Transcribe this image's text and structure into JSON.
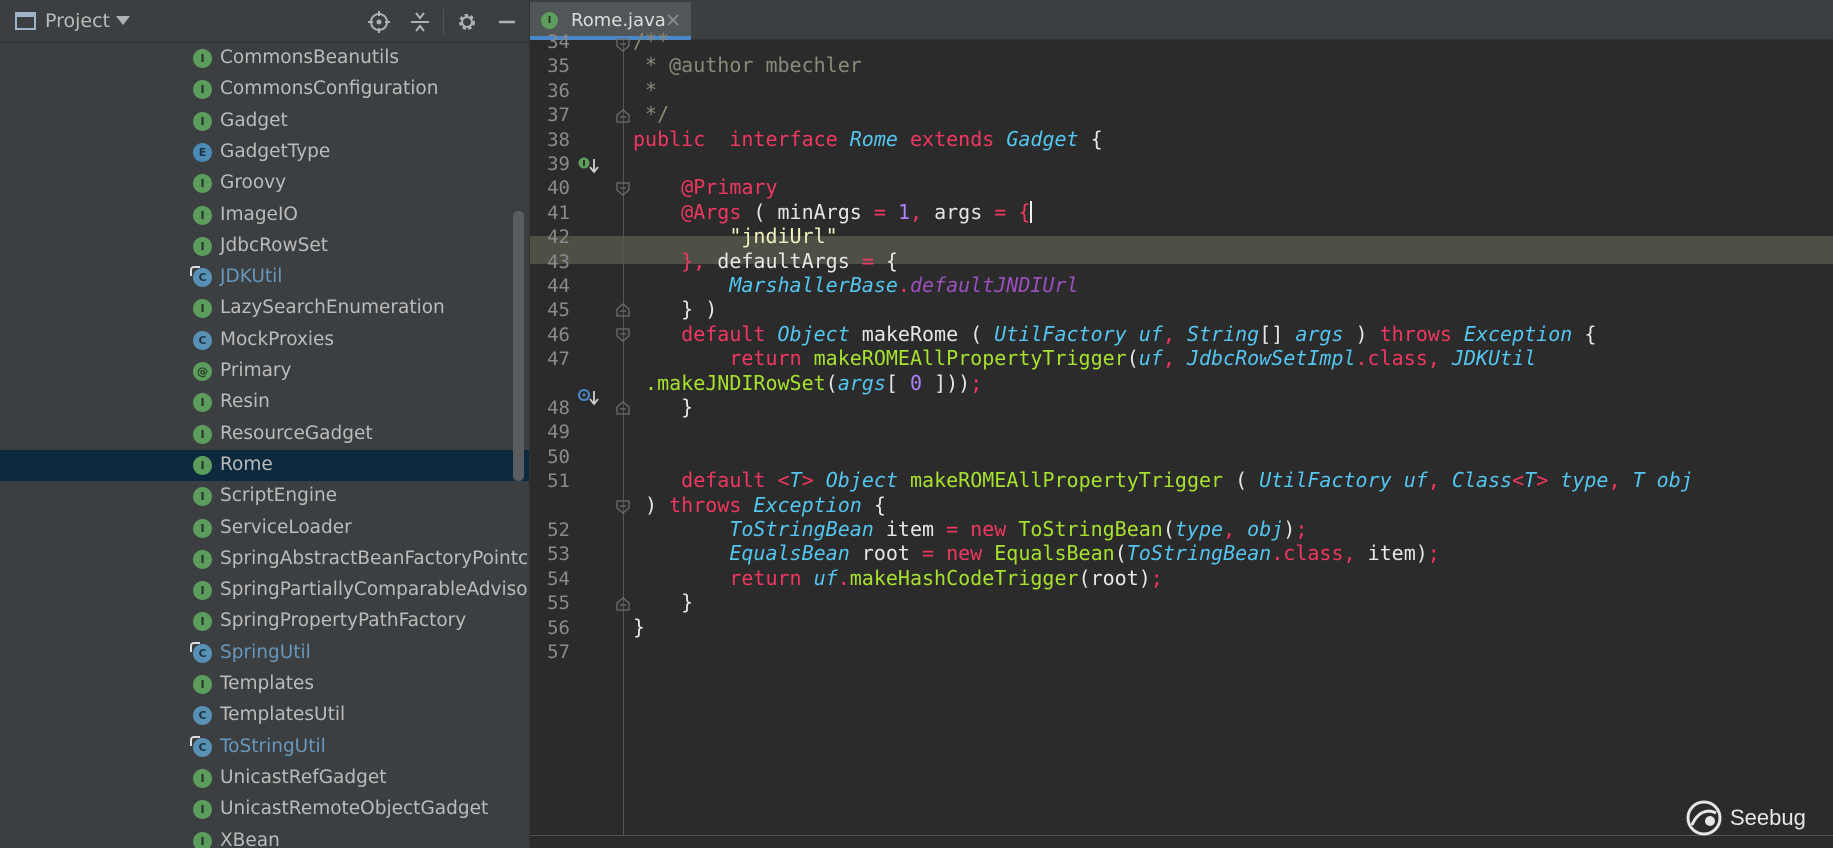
{
  "project_panel": {
    "title": "Project",
    "tree_items": [
      {
        "label": "CommonsBeanutils",
        "kind": "interface",
        "icon_letter": "I"
      },
      {
        "label": "CommonsConfiguration",
        "kind": "interface",
        "icon_letter": "I"
      },
      {
        "label": "Gadget",
        "kind": "interface",
        "icon_letter": "I"
      },
      {
        "label": "GadgetType",
        "kind": "enum",
        "icon_letter": "E"
      },
      {
        "label": "Groovy",
        "kind": "interface",
        "icon_letter": "I"
      },
      {
        "label": "ImageIO",
        "kind": "interface",
        "icon_letter": "I"
      },
      {
        "label": "JdbcRowSet",
        "kind": "interface",
        "icon_letter": "I"
      },
      {
        "label": "JDKUtil",
        "kind": "class-ext",
        "icon_letter": "C"
      },
      {
        "label": "LazySearchEnumeration",
        "kind": "interface",
        "icon_letter": "I"
      },
      {
        "label": "MockProxies",
        "kind": "class",
        "icon_letter": "C"
      },
      {
        "label": "Primary",
        "kind": "annotation",
        "icon_letter": "@"
      },
      {
        "label": "Resin",
        "kind": "interface",
        "icon_letter": "I"
      },
      {
        "label": "ResourceGadget",
        "kind": "interface",
        "icon_letter": "I"
      },
      {
        "label": "Rome",
        "kind": "interface",
        "icon_letter": "I",
        "selected": true
      },
      {
        "label": "ScriptEngine",
        "kind": "interface",
        "icon_letter": "I"
      },
      {
        "label": "ServiceLoader",
        "kind": "interface",
        "icon_letter": "I"
      },
      {
        "label": "SpringAbstractBeanFactoryPointcut",
        "kind": "interface",
        "icon_letter": "I"
      },
      {
        "label": "SpringPartiallyComparableAdvisorH",
        "kind": "interface",
        "icon_letter": "I"
      },
      {
        "label": "SpringPropertyPathFactory",
        "kind": "interface",
        "icon_letter": "I"
      },
      {
        "label": "SpringUtil",
        "kind": "class-ext",
        "icon_letter": "C"
      },
      {
        "label": "Templates",
        "kind": "interface",
        "icon_letter": "I"
      },
      {
        "label": "TemplatesUtil",
        "kind": "class",
        "icon_letter": "C"
      },
      {
        "label": "ToStringUtil",
        "kind": "class-ext",
        "icon_letter": "C"
      },
      {
        "label": "UnicastRefGadget",
        "kind": "interface",
        "icon_letter": "I"
      },
      {
        "label": "UnicastRemoteObjectGadget",
        "kind": "interface",
        "icon_letter": "I"
      },
      {
        "label": "XBean",
        "kind": "interface",
        "icon_letter": "I"
      }
    ]
  },
  "editor": {
    "tab": {
      "label": "Rome.java",
      "icon_letter": "I"
    },
    "caret_line_number": "41",
    "line_numbers": [
      "34",
      "35",
      "36",
      "37",
      "38",
      "39",
      "40",
      "41",
      "42",
      "43",
      "44",
      "45",
      "46",
      "47",
      "",
      "48",
      "49",
      "50",
      "51",
      "",
      "52",
      "53",
      "54",
      "55",
      "56",
      "57"
    ],
    "code_lines": [
      [
        [
          "cm",
          "/**"
        ]
      ],
      [
        [
          "cm",
          " * @author mbechler"
        ]
      ],
      [
        [
          "cm",
          " *"
        ]
      ],
      [
        [
          "cm",
          " */"
        ]
      ],
      [
        [
          "kw",
          "public"
        ],
        [
          "",
          "  "
        ],
        [
          "kw",
          "interface"
        ],
        [
          "",
          " "
        ],
        [
          "ty",
          "Rome"
        ],
        [
          "",
          " "
        ],
        [
          "kw",
          "extends"
        ],
        [
          "",
          " "
        ],
        [
          "ty",
          "Gadget"
        ],
        [
          "",
          " {"
        ]
      ],
      [
        [
          "",
          ""
        ]
      ],
      [
        [
          "",
          "    "
        ],
        [
          "an",
          "@Primary"
        ]
      ],
      [
        [
          "",
          "    "
        ],
        [
          "an",
          "@Args"
        ],
        [
          "",
          " ( minArgs "
        ],
        [
          "op",
          "="
        ],
        [
          "",
          " "
        ],
        [
          "nm",
          "1"
        ],
        [
          "op",
          ","
        ],
        [
          "",
          " args "
        ],
        [
          "op",
          "="
        ],
        [
          "",
          " "
        ],
        [
          "op",
          "{"
        ]
      ],
      [
        [
          "",
          "        "
        ],
        [
          "st",
          "\"jndiUrl\""
        ]
      ],
      [
        [
          "",
          "    "
        ],
        [
          "op",
          "},"
        ],
        [
          "",
          " defaultArgs "
        ],
        [
          "op",
          "="
        ],
        [
          "",
          " {"
        ]
      ],
      [
        [
          "",
          "        "
        ],
        [
          "ty",
          "MarshallerBase"
        ],
        [
          "op",
          "."
        ],
        [
          "fld",
          "defaultJNDIUrl"
        ]
      ],
      [
        [
          "",
          "    } )"
        ]
      ],
      [
        [
          "",
          "    "
        ],
        [
          "kw",
          "default"
        ],
        [
          "",
          " "
        ],
        [
          "ty",
          "Object"
        ],
        [
          "",
          " makeRome ( "
        ],
        [
          "ty",
          "UtilFactory"
        ],
        [
          "",
          " "
        ],
        [
          "pm",
          "uf"
        ],
        [
          "op",
          ","
        ],
        [
          "",
          " "
        ],
        [
          "ty",
          "String"
        ],
        [
          "",
          "[] "
        ],
        [
          "pm",
          "args"
        ],
        [
          "",
          " ) "
        ],
        [
          "kw",
          "throws"
        ],
        [
          "",
          " "
        ],
        [
          "ty",
          "Exception"
        ],
        [
          "",
          " {"
        ]
      ],
      [
        [
          "",
          "        "
        ],
        [
          "kw",
          "return"
        ],
        [
          "",
          " "
        ],
        [
          "fn",
          "makeROMEAllPropertyTrigger"
        ],
        [
          "",
          "("
        ],
        [
          "pm",
          "uf"
        ],
        [
          "op",
          ","
        ],
        [
          "",
          " "
        ],
        [
          "ty",
          "JdbcRowSetImpl"
        ],
        [
          "cls",
          ".class"
        ],
        [
          "op",
          ","
        ],
        [
          "",
          " "
        ],
        [
          "ty",
          "JDKUtil"
        ]
      ],
      [
        [
          "",
          "",
          " "
        ],
        [
          "fn",
          ".makeJNDIRowSet"
        ],
        [
          "",
          "("
        ],
        [
          "pm",
          "args"
        ],
        [
          "",
          "[ "
        ],
        [
          "nm",
          "0"
        ],
        [
          "",
          " ]))"
        ],
        [
          "op",
          ";"
        ]
      ],
      [
        [
          "",
          "    }"
        ]
      ],
      [
        [
          "",
          ""
        ]
      ],
      [
        [
          "",
          ""
        ]
      ],
      [
        [
          "",
          "    "
        ],
        [
          "kw",
          "default"
        ],
        [
          "",
          " "
        ],
        [
          "op",
          "<"
        ],
        [
          "ty",
          "T"
        ],
        [
          "op",
          ">"
        ],
        [
          "",
          " "
        ],
        [
          "ty",
          "Object"
        ],
        [
          "",
          " "
        ],
        [
          "fn",
          "makeROMEAllPropertyTrigger"
        ],
        [
          "",
          " ( "
        ],
        [
          "ty",
          "UtilFactory"
        ],
        [
          "",
          " "
        ],
        [
          "pm",
          "uf"
        ],
        [
          "op",
          ","
        ],
        [
          "",
          " "
        ],
        [
          "ty",
          "Class"
        ],
        [
          "op",
          "<"
        ],
        [
          "ty",
          "T"
        ],
        [
          "op",
          ">"
        ],
        [
          "",
          " "
        ],
        [
          "pm",
          "type"
        ],
        [
          "op",
          ","
        ],
        [
          "",
          " "
        ],
        [
          "ty",
          "T"
        ],
        [
          "",
          " "
        ],
        [
          "pm",
          "obj"
        ]
      ],
      [
        [
          "",
          "",
          " ) "
        ],
        [
          "kw",
          "throws"
        ],
        [
          "",
          " "
        ],
        [
          "ty",
          "Exception"
        ],
        [
          "",
          " {"
        ]
      ],
      [
        [
          "",
          "        "
        ],
        [
          "ty",
          "ToStringBean"
        ],
        [
          "",
          " item "
        ],
        [
          "op",
          "="
        ],
        [
          "",
          " "
        ],
        [
          "kw",
          "new"
        ],
        [
          "",
          " "
        ],
        [
          "fn",
          "ToStringBean"
        ],
        [
          "",
          "("
        ],
        [
          "pm",
          "type"
        ],
        [
          "op",
          ","
        ],
        [
          "",
          " "
        ],
        [
          "pm",
          "obj"
        ],
        [
          "",
          ")"
        ],
        [
          "op",
          ";"
        ]
      ],
      [
        [
          "",
          "        "
        ],
        [
          "ty",
          "EqualsBean"
        ],
        [
          "",
          " root "
        ],
        [
          "op",
          "="
        ],
        [
          "",
          " "
        ],
        [
          "kw",
          "new"
        ],
        [
          "",
          " "
        ],
        [
          "fn",
          "EqualsBean"
        ],
        [
          "",
          "("
        ],
        [
          "ty",
          "ToStringBean"
        ],
        [
          "cls",
          ".class"
        ],
        [
          "op",
          ","
        ],
        [
          "",
          " item)"
        ],
        [
          "op",
          ";"
        ]
      ],
      [
        [
          "",
          "        "
        ],
        [
          "kw",
          "return"
        ],
        [
          "",
          " "
        ],
        [
          "pm",
          "uf"
        ],
        [
          "op",
          "."
        ],
        [
          "fn",
          "makeHashCodeTrigger"
        ],
        [
          "",
          "(root)"
        ],
        [
          "op",
          ";"
        ]
      ],
      [
        [
          "",
          "    }"
        ]
      ],
      [
        [
          "",
          "}"
        ]
      ],
      [
        [
          "",
          ""
        ]
      ]
    ]
  },
  "watermark": {
    "text": "Seebug"
  },
  "colors": {
    "selection": "#0d293e",
    "caret_line": "#4e5046",
    "keyword": "#f0375f",
    "type": "#54c5ef",
    "method": "#a6e22e"
  }
}
